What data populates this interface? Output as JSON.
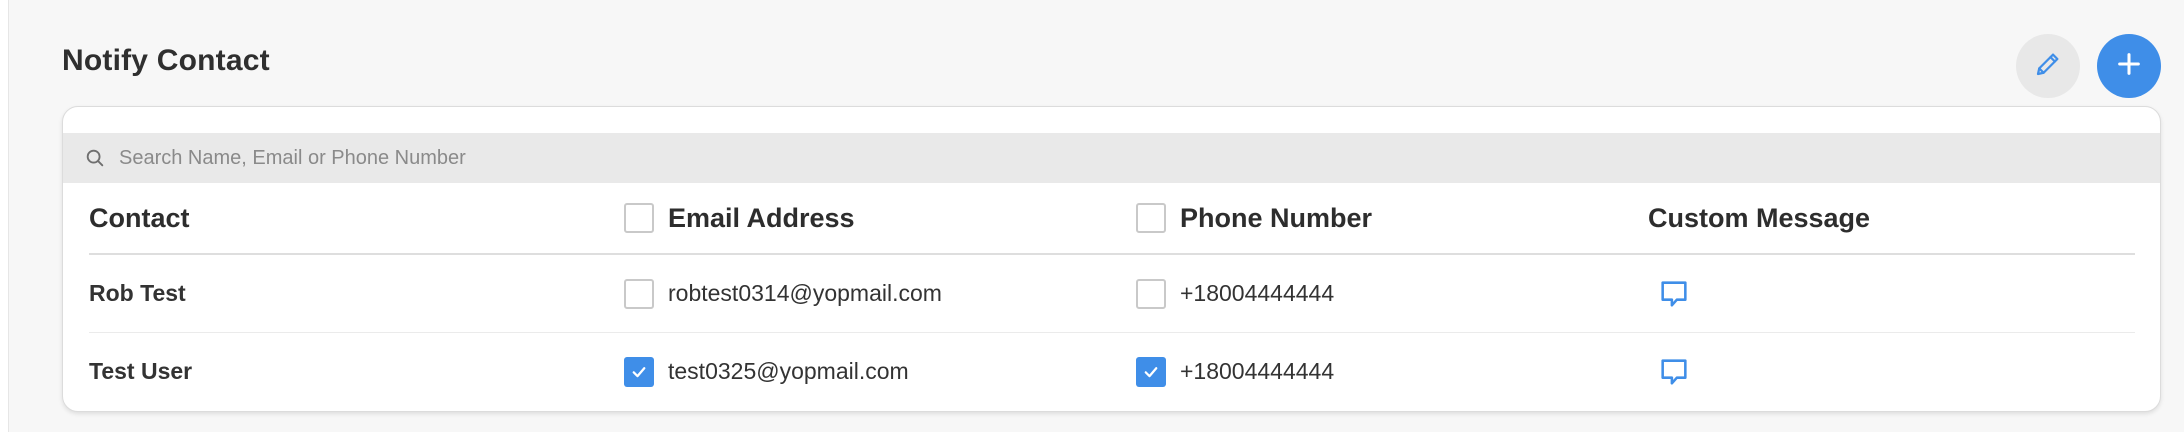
{
  "section": {
    "title": "Notify Contact"
  },
  "actions": {
    "edit_icon": "pencil-icon",
    "add_icon": "plus-icon",
    "accent_color": "#3f8ee8"
  },
  "search": {
    "placeholder": "Search Name, Email or Phone Number",
    "value": ""
  },
  "table": {
    "headers": {
      "contact": "Contact",
      "email": "Email Address",
      "phone": "Phone Number",
      "message": "Custom Message"
    },
    "header_email_checked": false,
    "header_phone_checked": false,
    "rows": [
      {
        "name": "Rob Test",
        "email": "robtest0314@yopmail.com",
        "email_checked": false,
        "phone": "+18004444444",
        "phone_checked": false,
        "message_icon": "chat-bubble-icon"
      },
      {
        "name": "Test User",
        "email": "test0325@yopmail.com",
        "email_checked": true,
        "phone": "+18004444444",
        "phone_checked": true,
        "message_icon": "chat-bubble-icon"
      }
    ]
  }
}
